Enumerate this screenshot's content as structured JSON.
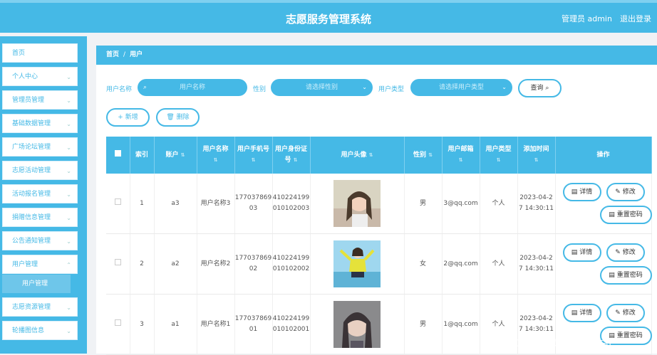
{
  "header": {
    "title": "志愿服务管理系统",
    "admin": "管理员 admin",
    "logout": "退出登录"
  },
  "sidebar": {
    "items": [
      {
        "label": "首页"
      },
      {
        "label": "个人中心"
      },
      {
        "label": "管理员管理"
      },
      {
        "label": "基础数据管理"
      },
      {
        "label": "广场论坛管理"
      },
      {
        "label": "志愿活动管理"
      },
      {
        "label": "活动报名管理"
      },
      {
        "label": "捐赠信息管理"
      },
      {
        "label": "公告通知管理"
      },
      {
        "label": "用户管理"
      },
      {
        "label": "志愿资源管理"
      },
      {
        "label": "轮播图信息"
      }
    ],
    "active_sub": "用户管理"
  },
  "breadcrumb": {
    "home": "首页",
    "sep": "/",
    "current": "用户"
  },
  "search": {
    "name_label": "用户名称",
    "name_placeholder": "用户名称",
    "gender_label": "性别",
    "gender_placeholder": "请选择性别",
    "type_label": "用户类型",
    "type_placeholder": "请选择用户类型",
    "query_label": "查询"
  },
  "actions": {
    "add": "新增",
    "delete": "删除"
  },
  "table": {
    "headers": [
      "索引",
      "账户",
      "用户名称",
      "用户手机号",
      "用户身份证号",
      "用户头像",
      "性别",
      "用户邮箱",
      "用户类型",
      "添加时间",
      "操作"
    ],
    "rows": [
      {
        "index": "1",
        "account": "a3",
        "name": "用户名称3",
        "phone": "17703786903",
        "idcard": "410224199010102003",
        "gender": "男",
        "email": "3@qq.com",
        "type": "个人",
        "time": "2023-04-27 14:30:11"
      },
      {
        "index": "2",
        "account": "a2",
        "name": "用户名称2",
        "phone": "17703786902",
        "idcard": "410224199010102002",
        "gender": "女",
        "email": "2@qq.com",
        "type": "个人",
        "time": "2023-04-27 14:30:11"
      },
      {
        "index": "3",
        "account": "a1",
        "name": "用户名称1",
        "phone": "17703786901",
        "idcard": "410224199010102001",
        "gender": "男",
        "email": "1@qq.com",
        "type": "个人",
        "time": "2023-04-27 14:30:11"
      }
    ],
    "ops": {
      "detail": "详情",
      "edit": "修改",
      "reset": "重置密码"
    }
  },
  "watermark": "CSDN @爱编程的小白L",
  "colors": {
    "primary": "#45b9e6",
    "sidebar": "#45b9e6",
    "active": "#6ec6ea"
  }
}
